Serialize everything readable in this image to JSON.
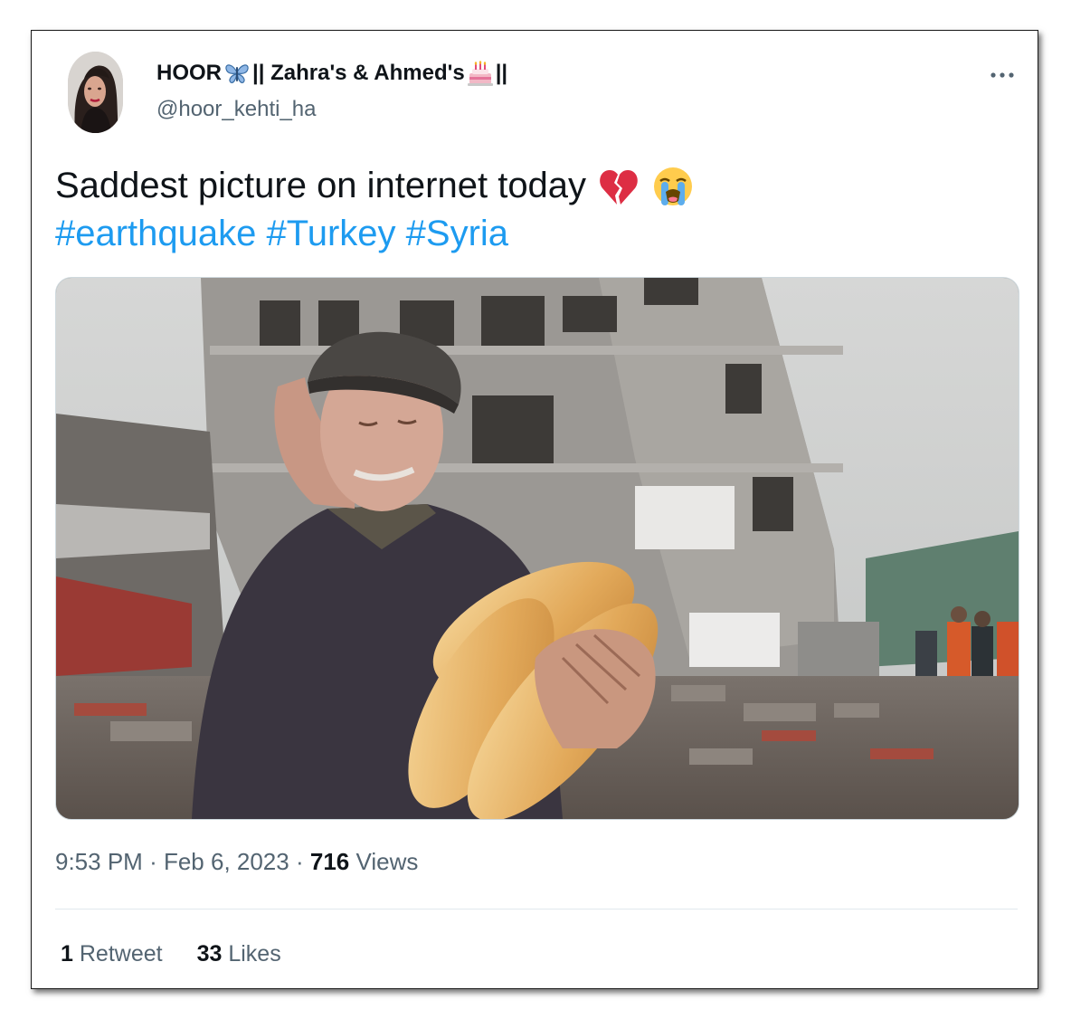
{
  "tweet": {
    "author": {
      "name_part1": "HOOR",
      "name_part2": "|| Zahra's & Ahmed's",
      "name_part3": "||",
      "name_emoji_1": "butterfly-icon",
      "name_emoji_2": "birthday-cake-icon",
      "handle": "@hoor_kehti_ha",
      "avatar": "avatar-photo"
    },
    "more_icon": "more-dots-icon",
    "text_line1": "Saddest picture on internet today",
    "text_emojis": [
      "broken-heart-icon",
      "loudly-crying-face-icon"
    ],
    "hashtags": [
      "#earthquake",
      "#Turkey",
      "#Syria"
    ],
    "media": {
      "kind": "photo",
      "subject": "elderly-man-holding-bread-photo"
    },
    "meta": {
      "time": "9:53 PM",
      "separator": " · ",
      "date": "Feb 6, 2023",
      "views_count": "716",
      "views_label": "Views"
    },
    "stats": {
      "retweets_count": "1",
      "retweets_label": "Retweet",
      "likes_count": "33",
      "likes_label": "Likes"
    },
    "colors": {
      "text": "#0f1419",
      "secondary": "#536471",
      "link": "#1d9bf0",
      "divider": "#e1e8ed"
    }
  }
}
